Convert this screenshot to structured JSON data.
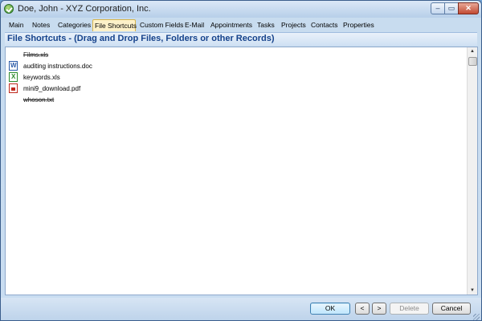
{
  "window": {
    "title": "Doe, John - XYZ Corporation, Inc.",
    "controls": {
      "minimize": "–",
      "maximize": "▭",
      "close": "✕"
    }
  },
  "tabs": [
    {
      "label": "Main",
      "active": false
    },
    {
      "label": "Notes",
      "active": false
    },
    {
      "label": "Categories",
      "active": false
    },
    {
      "label": "File Shortcuts",
      "active": true
    },
    {
      "label": "Custom Fields",
      "active": false
    },
    {
      "label": "E-Mail",
      "active": false
    },
    {
      "label": "Appointments",
      "active": false
    },
    {
      "label": "Tasks",
      "active": false
    },
    {
      "label": "Projects",
      "active": false
    },
    {
      "label": "Contacts",
      "active": false
    },
    {
      "label": "Properties",
      "active": false
    }
  ],
  "panel": {
    "header": "File Shortcuts - (Drag and Drop Files, Folders or other Records)"
  },
  "files": [
    {
      "name": "Films.xls",
      "icon": "none",
      "missing": true
    },
    {
      "name": "auditing instructions.doc",
      "icon": "word-doc-icon",
      "missing": false
    },
    {
      "name": "keywords.xls",
      "icon": "excel-xls-icon",
      "missing": false
    },
    {
      "name": "mini9_download.pdf",
      "icon": "pdf-icon",
      "missing": false
    },
    {
      "name": "whoson.txt",
      "icon": "none",
      "missing": true
    }
  ],
  "scrollbar": {
    "up": "▲",
    "down": "▼"
  },
  "buttons": {
    "ok": "OK",
    "prev": "<",
    "next": ">",
    "delete": "Delete",
    "cancel": "Cancel"
  },
  "colors": {
    "header_text": "#15428b",
    "active_tab": "#fdf1c9",
    "close_button": "#c24a33"
  }
}
